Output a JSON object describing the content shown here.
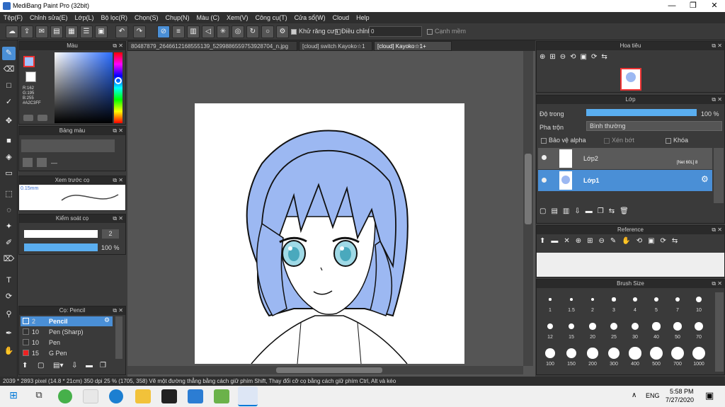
{
  "window": {
    "title": "MediBang Paint Pro (32bit)",
    "minimize": "—",
    "maximize": "❐",
    "close": "✕"
  },
  "menu": [
    "Tệp(F)",
    "Chỉnh sửa(E)",
    "Lớp(L)",
    "Bộ lọc(R)",
    "Chọn(S)",
    "Chụp(N)",
    "Màu (C)",
    "Xem(V)",
    "Công cụ(T)",
    "Cửa sổ(W)",
    "Cloud",
    "Help"
  ],
  "toolbar": {
    "antialias_label": "Khử răng cưa",
    "adjust_label": "Điều chỉnh",
    "adjust_value": "0",
    "edge_label": "Cạnh mềm"
  },
  "tabs": [
    "80487879_2646612168555139_5299886559753928704_n.jpg",
    "[cloud] switch Kayoko☆1",
    "[cloud] Kayoko☆1+"
  ],
  "color_panel": {
    "title": "Màu",
    "r": "R:162",
    "g": "G:195",
    "b": "B:255",
    "hex": "#A2C3FF",
    "fg": "#a2c3ff"
  },
  "swatch_panel": {
    "title": "Bảng màu",
    "dash": "—"
  },
  "brush_preview": {
    "title": "Xem trước cọ",
    "size": "0.15mm"
  },
  "brush_control": {
    "title": "Kiểm soát cọ",
    "size_value": "2",
    "opacity_value": "100 %"
  },
  "brush_list": {
    "title": "Cọ: Pencil",
    "items": [
      {
        "size": "2",
        "name": "Pencil",
        "color": "#4a8fd6"
      },
      {
        "size": "10",
        "name": "Pen (Sharp)",
        "color": "#333"
      },
      {
        "size": "10",
        "name": "Pen",
        "color": "#333"
      },
      {
        "size": "15",
        "name": "G Pen",
        "color": "#e22"
      }
    ]
  },
  "navigator": {
    "title": "Hoa tiêu"
  },
  "layer_panel": {
    "title": "Lớp",
    "opacity_label": "Độ trong",
    "opacity_value": "100 %",
    "blend_label": "Pha trộn",
    "blend_value": "Bình thường",
    "protect_alpha": "Bảo vệ alpha",
    "clipping": "Xén bớt",
    "lock": "Khóa",
    "layers": [
      {
        "name": "Lớp2",
        "tag": "[Net 60L] 8"
      },
      {
        "name": "Lớp1"
      }
    ]
  },
  "reference_panel": {
    "title": "Reference"
  },
  "brush_size_panel": {
    "title": "Brush Size",
    "sizes": [
      "1",
      "1.5",
      "2",
      "3",
      "4",
      "5",
      "7",
      "10",
      "12",
      "15",
      "20",
      "25",
      "30",
      "40",
      "50",
      "70",
      "100",
      "150",
      "200",
      "300",
      "400",
      "500",
      "700",
      "1000"
    ]
  },
  "status": "2039 * 2893 pixel (14.8 * 21cm) 350 dpi 25 % (1705, 358) Vẽ một đường thẳng bằng cách giữ phím Shift, Thay đổi cỡ cọ bằng cách giữ phím Ctrl, Alt và kéo",
  "taskbar": {
    "lang": "ENG",
    "time": "5:58 PM",
    "date": "7/27/2020"
  }
}
